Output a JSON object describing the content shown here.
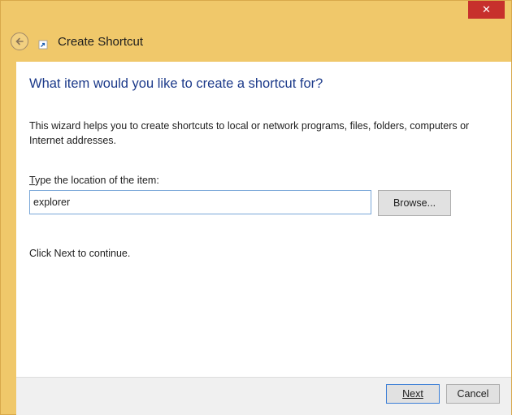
{
  "window": {
    "title": "Create Shortcut",
    "close_glyph": "✕"
  },
  "wizard": {
    "heading": "What item would you like to create a shortcut for?",
    "description": "This wizard helps you to create shortcuts to local or network programs, files, folders, computers or Internet addresses.",
    "field_label_mnemonic": "T",
    "field_label_rest": "ype the location of the item:",
    "location_value": "explorer",
    "browse_label": "Browse...",
    "continue_text": "Click Next to continue."
  },
  "footer": {
    "next_label": "Next",
    "cancel_label": "Cancel"
  },
  "colors": {
    "frame": "#f0c86a",
    "heading": "#1c3a8a",
    "close": "#c7302c"
  },
  "icons": {
    "back": "back-arrow-icon",
    "shortcut": "shortcut-arrow-icon",
    "close": "close-icon"
  }
}
